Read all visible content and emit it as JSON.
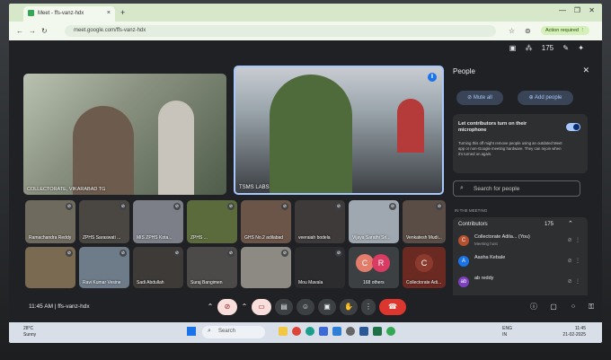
{
  "browser": {
    "tab_title": "Meet - ffs-vanz-hdx",
    "url": "meet.google.com/ffs-vanz-hdx",
    "action_required": "Action required"
  },
  "meet": {
    "participant_count": "175",
    "main_tiles": [
      {
        "name": "COLLECTORATE, VIKARABAD TG"
      },
      {
        "name": "TSMS LABS"
      }
    ],
    "grid_tiles": [
      {
        "name": "Ramachandra Reddy"
      },
      {
        "name": "ZPHS Saraswati ..."
      },
      {
        "name": "MIS ZPHS Kota..."
      },
      {
        "name": "ZPHS ..."
      },
      {
        "name": "GHS No.2 adilabad"
      },
      {
        "name": "veeraiah bodela"
      },
      {
        "name": "Vijaya Sarathi Sri..."
      },
      {
        "name": "Venkatesh Mudi..."
      },
      {
        "name": ""
      },
      {
        "name": "Ravi Kumar Vesine"
      },
      {
        "name": "Sadi Abdullah"
      },
      {
        "name": "Suraj Bangimen"
      },
      {
        "name": ""
      },
      {
        "name": "Mou Mavala"
      },
      {
        "name": "168 others"
      },
      {
        "name": "Collectorate Adi..."
      }
    ],
    "others_avatars": [
      "C",
      "R"
    ],
    "collectorate_avatar": "C",
    "meeting_code": "11:45 AM | ffs-vanz-hdx"
  },
  "people_panel": {
    "title": "People",
    "mute_all": "Mute all",
    "add_people": "Add people",
    "info_title": "Let contributors turn on their microphone",
    "info_text": "Turning this off might remove people using an outdated Meet app or non-Google meeting hardware. They can rejoin when it's turned on again.",
    "search_placeholder": "Search for people",
    "section_label": "IN THE MEETING",
    "contributors_label": "Contributors",
    "contributors_count": "175",
    "people": [
      {
        "initial": "C",
        "name": "Collectorate Adila... (You)",
        "sub": "Meeting host",
        "color": "#b5502f"
      },
      {
        "initial": "A",
        "name": "Aasha Kebale",
        "sub": "",
        "color": "#1a73e8"
      },
      {
        "initial": "ab",
        "name": "ab reddy",
        "sub": "",
        "color": "#7b3fbf"
      }
    ]
  },
  "taskbar": {
    "weather_temp": "28°C",
    "weather_desc": "Sunny",
    "search": "Search",
    "lang": "ENG",
    "lang2": "IN",
    "time": "11:45",
    "date": "21-02-2025"
  }
}
